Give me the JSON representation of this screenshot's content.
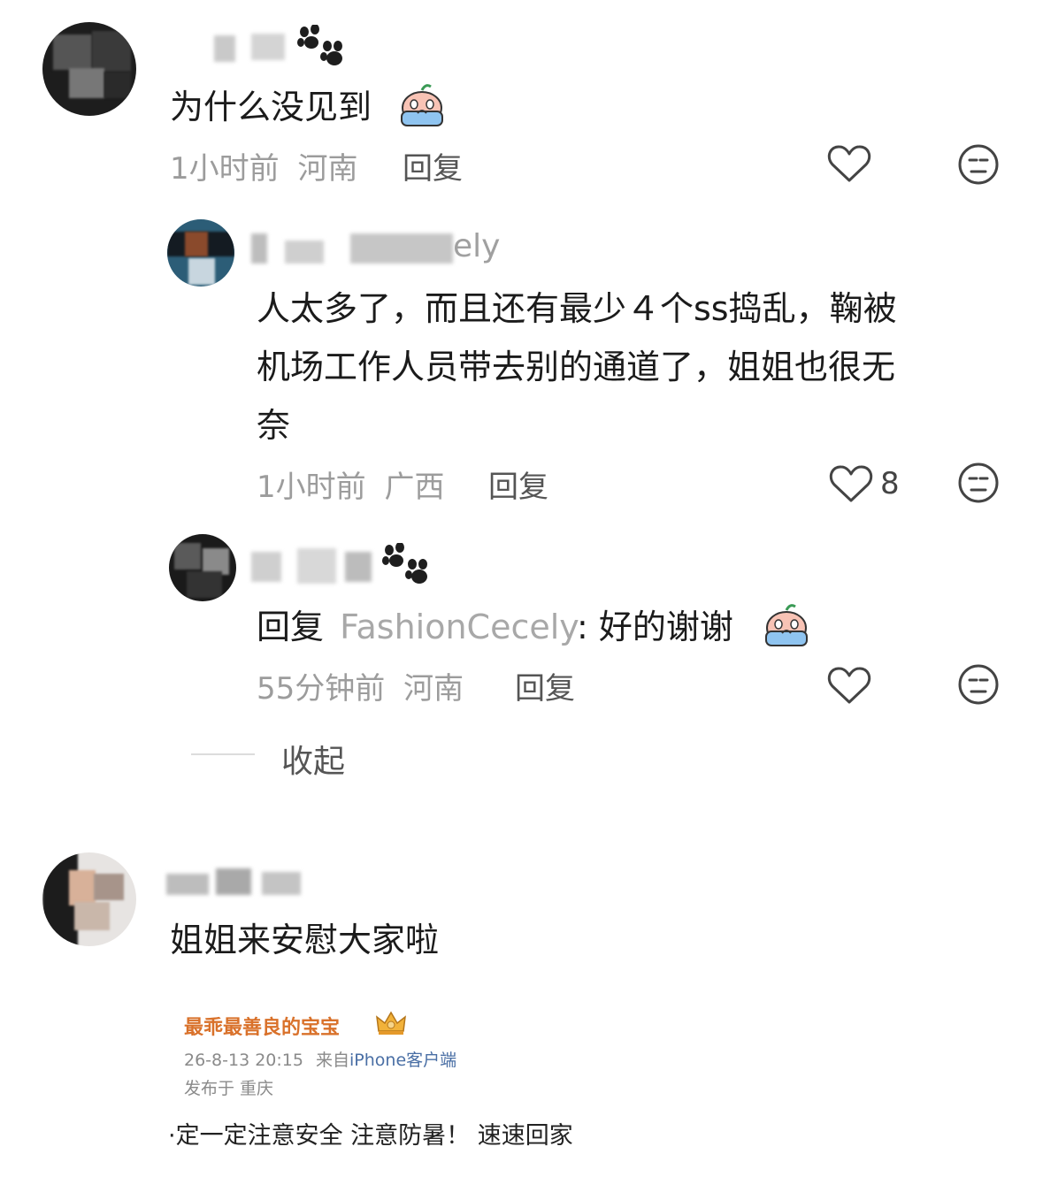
{
  "comments": [
    {
      "text": "为什么没见到",
      "time": "1小时前",
      "location": "河南",
      "reply_label": "回复",
      "like_count": "",
      "replies": [
        {
          "nickname_suffix": "ely",
          "text_lines": [
            "人太多了，而且还有最少４个ss捣乱，鞠被",
            "机场工作人员带去别的通道了，姐姐也很无",
            "奈"
          ],
          "time": "1小时前",
          "location": "广西",
          "reply_label": "回复",
          "like_count": "8"
        },
        {
          "reply_prefix": "回复",
          "mention": "FashionCecely",
          "text": ": 好的谢谢",
          "time": "55分钟前",
          "location": "河南",
          "reply_label": "回复",
          "like_count": ""
        }
      ],
      "collapse_label": "收起"
    },
    {
      "text": "姐姐来安慰大家啦",
      "quoted_post": {
        "author": "最乖最善良的宝宝",
        "date": "26-8-13 20:15",
        "source_prefix": "来自",
        "source": "iPhone客户端",
        "location": "发布于  重庆",
        "text": "·定一定注意安全 注意防暑！ 速速回家"
      }
    }
  ],
  "icons": {
    "like": "heart-outline-icon",
    "dislike": "neutral-face-icon",
    "badge": "paw-print-icon",
    "emoji": "crying-face-emoji",
    "crown": "crown-icon"
  },
  "colors": {
    "text": "#1b1b1b",
    "meta": "#9c9c9c",
    "mention": "#a8a8a8",
    "quote_author": "#d9712a",
    "quote_source": "#4a6fa5"
  }
}
